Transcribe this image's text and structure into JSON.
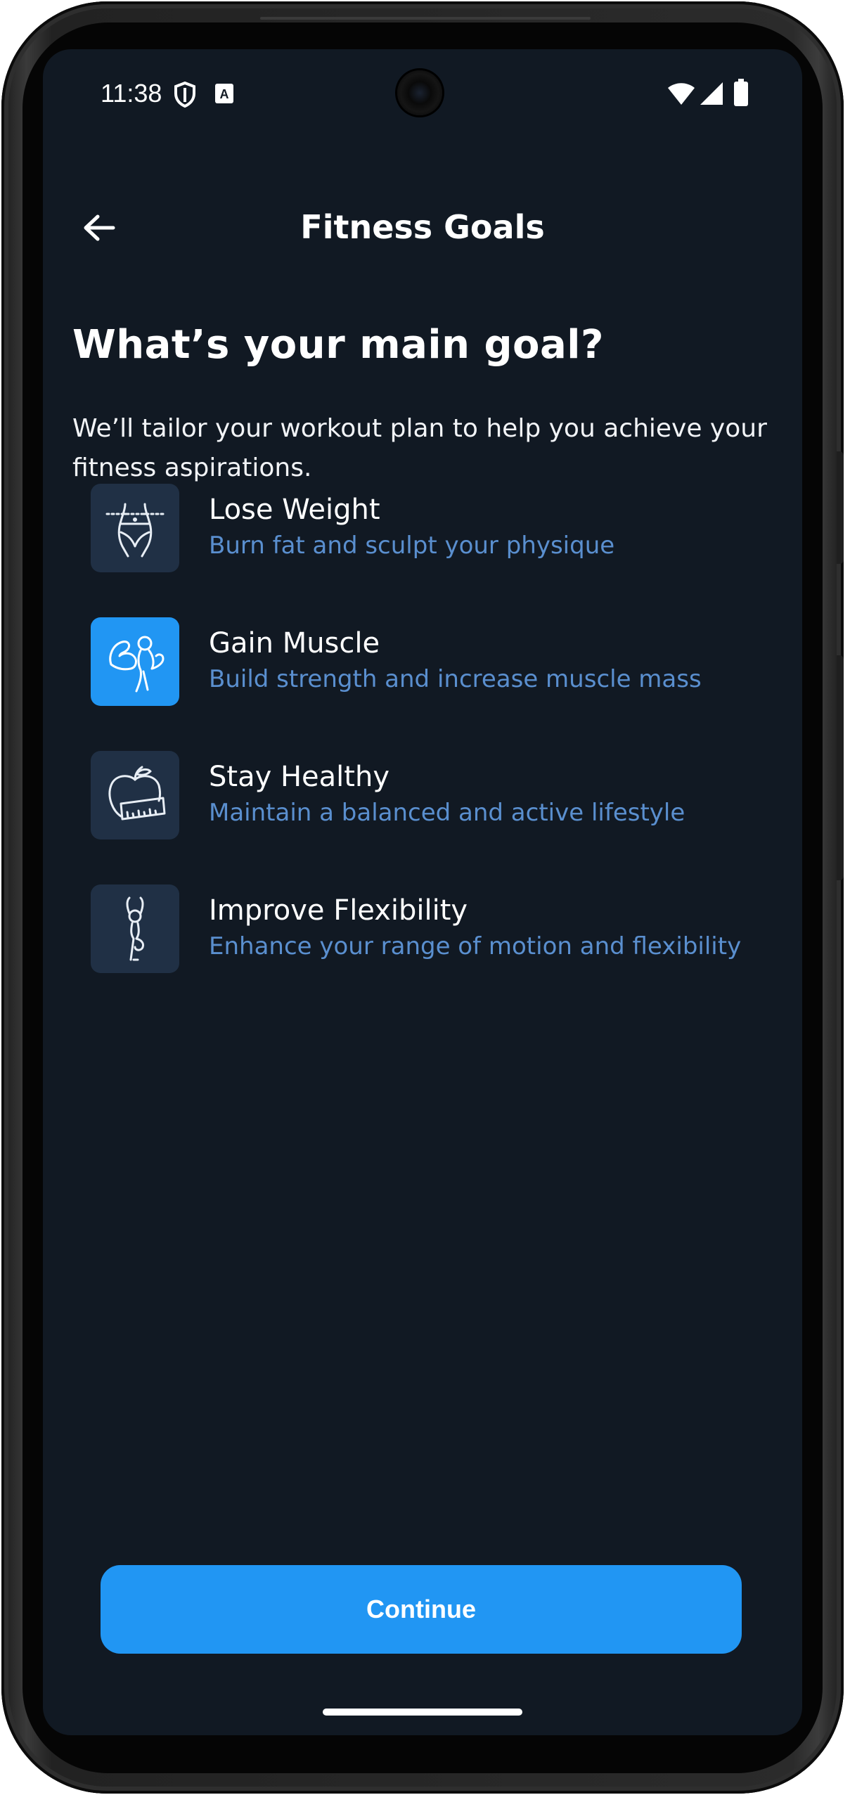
{
  "status_bar": {
    "time": "11:38",
    "icons": [
      "shield-icon",
      "keyboard-a-icon",
      "wifi-icon",
      "signal-icon",
      "battery-icon"
    ]
  },
  "app_bar": {
    "title": "Fitness Goals",
    "back_icon": "arrow-left-icon"
  },
  "content": {
    "heading": "What’s your main goal?",
    "subheading": "We’ll tailor your workout plan to help you achieve your fitness aspirations."
  },
  "goals": [
    {
      "title": "Lose Weight",
      "description": "Burn fat and sculpt your physique",
      "icon": "waist-measure-icon",
      "selected": false
    },
    {
      "title": "Gain Muscle",
      "description": "Build strength and increase muscle mass",
      "icon": "flexing-arm-icon",
      "selected": true
    },
    {
      "title": "Stay Healthy",
      "description": "Maintain a balanced and active lifestyle",
      "icon": "apple-tape-icon",
      "selected": false
    },
    {
      "title": "Improve Flexibility",
      "description": "Enhance your range of motion and flexibility",
      "icon": "yoga-pose-icon",
      "selected": false
    }
  ],
  "actions": {
    "continue_label": "Continue"
  },
  "colors": {
    "background": "#111923",
    "accent": "#2196f3",
    "tile": "#203045",
    "description": "#5a8fcf"
  }
}
